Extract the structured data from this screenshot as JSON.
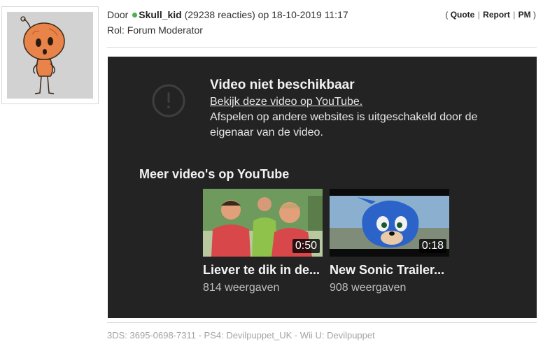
{
  "post": {
    "by_label": "Door",
    "username": "Skull_kid",
    "reactions": "(29238 reacties)",
    "date_prefix": "op",
    "datetime": "18-10-2019 11:17",
    "role": "Rol: Forum Moderator",
    "online_color": "#4caf50"
  },
  "actions": {
    "open": "(",
    "quote": "Quote",
    "sep1": "|",
    "report": "Report",
    "sep2": "|",
    "pm": "PM",
    "close": ")"
  },
  "video_embed": {
    "icon": "exclamation-circle-icon",
    "title": "Video niet beschikbaar",
    "link_text": "Bekijk deze video op YouTube.",
    "description": "Afspelen op andere websites is uitgeschakeld door de eigenaar van de video.",
    "more_title": "Meer video's op YouTube",
    "videos": [
      {
        "title": "Liever te dik in de...",
        "views": "814 weergaven",
        "duration": "0:50"
      },
      {
        "title": "New Sonic Trailer...",
        "views": "908 weergaven",
        "duration": "0:18"
      }
    ]
  },
  "signature": "3DS: 3695-0698-7311 - PS4: Devilpuppet_UK - Wii U: Devilpuppet"
}
